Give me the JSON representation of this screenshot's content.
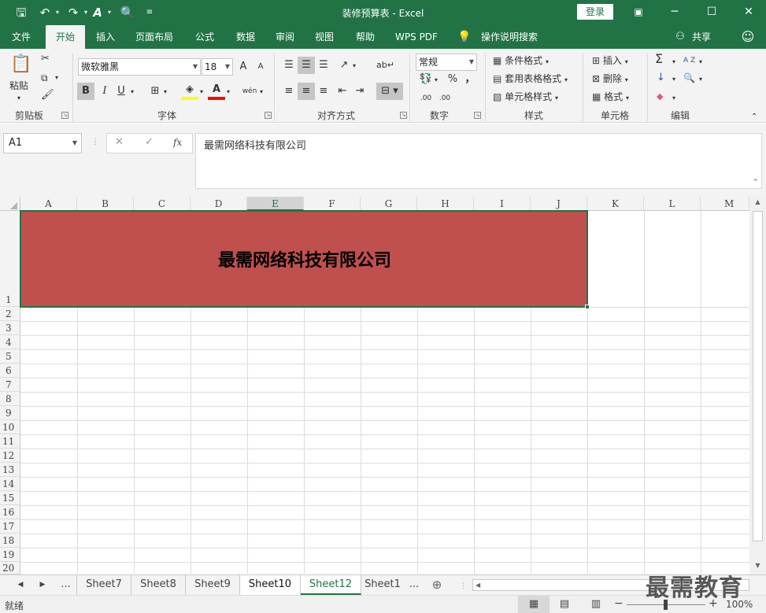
{
  "window": {
    "title": "装修预算表 - Excel",
    "login_label": "登录",
    "restore_icon": "ribbon-display-icon",
    "minimize": "─",
    "maximize": "☐",
    "close": "✕"
  },
  "quick_access": {
    "save": "🖫",
    "undo": "↶",
    "redo": "↷",
    "format_painter": "A",
    "preview": "🔍",
    "more": "≡"
  },
  "tabs": [
    {
      "label": "文件"
    },
    {
      "label": "开始"
    },
    {
      "label": "插入"
    },
    {
      "label": "页面布局"
    },
    {
      "label": "公式"
    },
    {
      "label": "数据"
    },
    {
      "label": "审阅"
    },
    {
      "label": "视图"
    },
    {
      "label": "帮助"
    },
    {
      "label": "WPS PDF"
    },
    {
      "label": "操作说明搜索"
    }
  ],
  "share_label": "共享",
  "ribbon": {
    "clipboard": {
      "label": "剪贴板",
      "paste": "粘贴"
    },
    "font": {
      "label": "字体",
      "font_name": "微软雅黑",
      "font_size": "18",
      "bold": "B",
      "italic": "I",
      "underline": "U",
      "grow": "A",
      "shrink": "A",
      "phonetic": "wén"
    },
    "alignment": {
      "label": "对齐方式"
    },
    "number": {
      "label": "数字",
      "format": "常规",
      "percent": "%",
      "comma": "，",
      "inc_decimal": ".00",
      "dec_decimal": ".00"
    },
    "styles": {
      "label": "样式",
      "conditional": "条件格式",
      "table_format": "套用表格格式",
      "cell_styles": "单元格样式"
    },
    "cells": {
      "label": "单元格",
      "insert": "插入",
      "delete": "删除",
      "format": "格式"
    },
    "editing": {
      "label": "编辑",
      "sum": "Σ",
      "sort": "A Z",
      "fill": "↓",
      "find": "🔍",
      "clear": "◆"
    }
  },
  "formula_bar": {
    "name_box": "A1",
    "cancel": "✕",
    "enter": "✓",
    "fx": "fx",
    "content": "最需网络科技有限公司"
  },
  "columns": [
    "A",
    "B",
    "C",
    "D",
    "E",
    "F",
    "G",
    "H",
    "I",
    "J",
    "K",
    "L",
    "M"
  ],
  "rows": [
    "1",
    "2",
    "3",
    "4",
    "5",
    "6",
    "7",
    "8",
    "9",
    "10",
    "11",
    "12",
    "13",
    "14",
    "15",
    "16",
    "17",
    "18",
    "19",
    "20"
  ],
  "cell_a1": {
    "text": "最需网络科技有限公司",
    "fill": "#c0504d"
  },
  "sheets": [
    "Sheet7",
    "Sheet8",
    "Sheet9",
    "Sheet10",
    "Sheet12",
    "Sheet1"
  ],
  "sheet_nav": {
    "prev": "◀",
    "next": "▶",
    "more_left": "...",
    "more_right": "...",
    "add": "⊕"
  },
  "status": {
    "ready": "就绪",
    "zoom": "100%",
    "zoom_minus": "−",
    "zoom_plus": "+"
  },
  "watermark": "最需教育",
  "colors": {
    "accent": "#217346",
    "cell_fill": "#c0504d"
  }
}
